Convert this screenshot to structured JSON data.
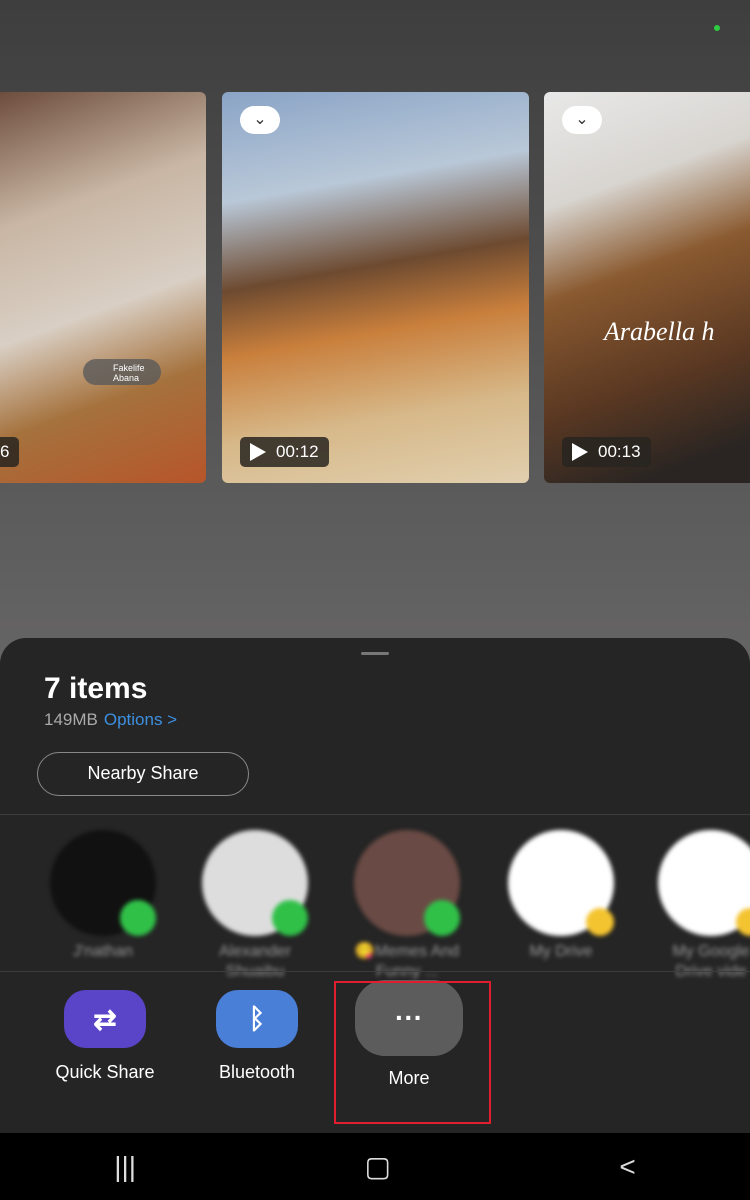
{
  "thumbnails": [
    {
      "duration": "6",
      "music_tag": {
        "title": "Fakelife",
        "artist": "Abana"
      }
    },
    {
      "duration": "00:12",
      "selected": true
    },
    {
      "duration": "00:13",
      "selected": true,
      "caption": "Arabella h"
    }
  ],
  "sheet": {
    "title": "7 items",
    "size": "149MB",
    "options_label": "Options >",
    "nearby_share": "Nearby Share"
  },
  "contacts": [
    {
      "name": "J'nathan",
      "badge": "whatsapp"
    },
    {
      "name": "Alexander Shuaibu",
      "badge": "whatsapp"
    },
    {
      "name": "😋Memes And Funny ...",
      "badge": "whatsapp"
    },
    {
      "name": "My Drive",
      "badge": "google-drive"
    },
    {
      "name": "My Google Drive vide",
      "badge": "google-drive"
    }
  ],
  "apps": [
    {
      "label": "Quick Share",
      "icon": "quick-share-icon",
      "color": "#5a44c8"
    },
    {
      "label": "Bluetooth",
      "icon": "bluetooth-icon",
      "color": "#4a7fd8"
    },
    {
      "label": "More",
      "icon": "more-icon",
      "color": "#5c5c5c",
      "highlighted": true
    }
  ],
  "nav": {
    "recents": "|||",
    "home": "▢",
    "back": "<"
  }
}
